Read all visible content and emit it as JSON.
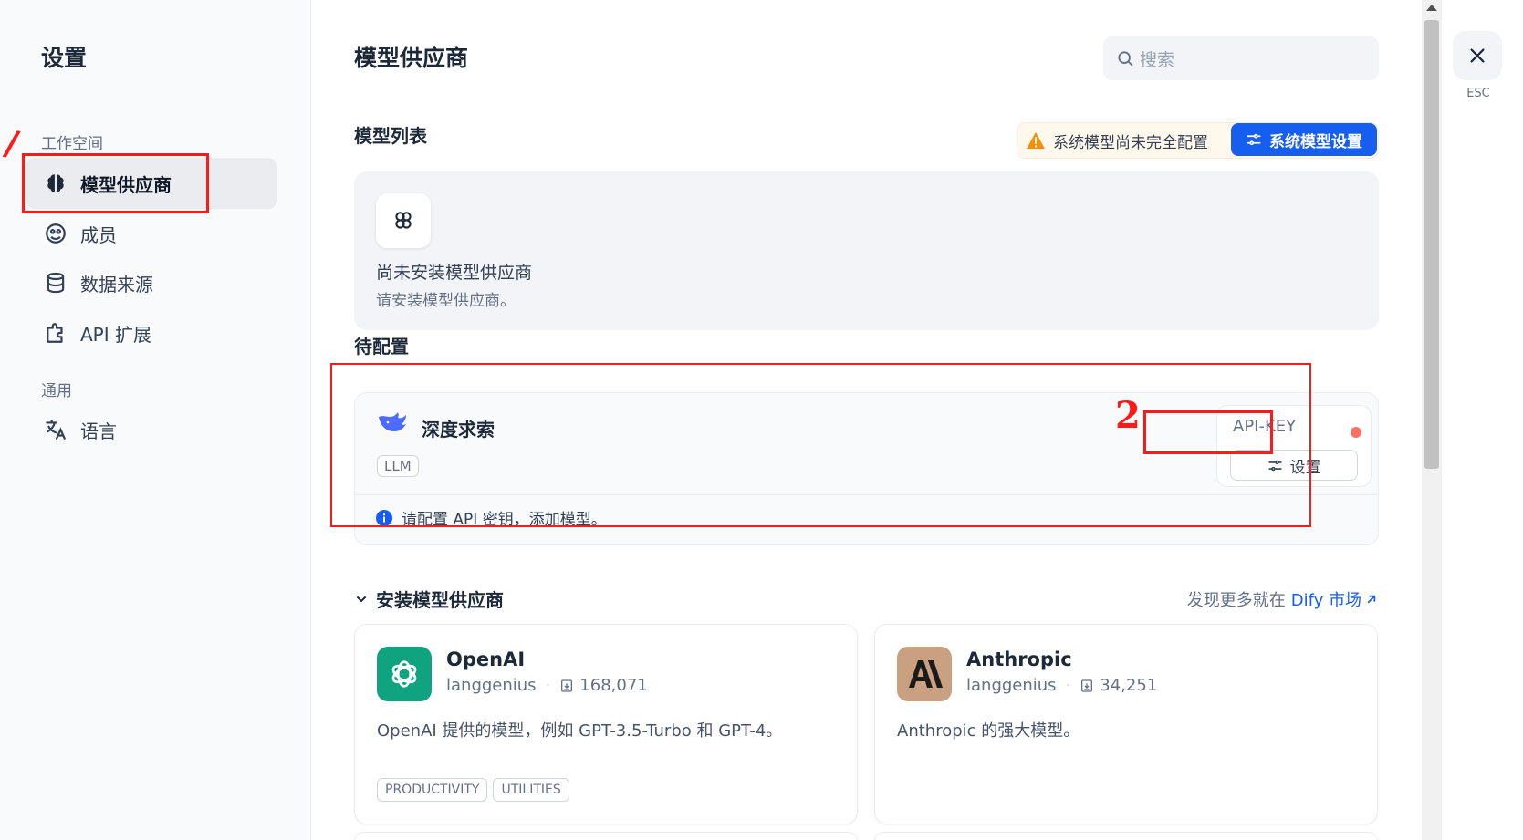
{
  "sidebar": {
    "title": "设置",
    "workspace_label": "工作空间",
    "general_label": "通用",
    "items": [
      {
        "label": "模型供应商",
        "icon": "brain-icon"
      },
      {
        "label": "成员",
        "icon": "members-icon"
      },
      {
        "label": "数据来源",
        "icon": "database-icon"
      },
      {
        "label": "API 扩展",
        "icon": "puzzle-icon"
      },
      {
        "label": "语言",
        "icon": "translate-icon"
      }
    ]
  },
  "main": {
    "title": "模型供应商",
    "search_placeholder": "搜索",
    "model_list_label": "模型列表",
    "warning_text": "系统模型尚未完全配置",
    "system_settings_button": "系统模型设置",
    "empty_title": "尚未安装模型供应商",
    "empty_desc": "请安装模型供应商。",
    "pending_label": "待配置",
    "pending_provider": {
      "name": "深度求索",
      "tag": "LLM",
      "apikey_label": "API-KEY",
      "setup_button": "设置",
      "info": "请配置 API 密钥，添加模型。"
    },
    "install_label": "安装模型供应商",
    "market_prefix": "发现更多就在",
    "market_link": "Dify 市场",
    "plugins": [
      {
        "name": "OpenAI",
        "author": "langgenius",
        "downloads": "168,071",
        "desc": "OpenAI 提供的模型，例如 GPT-3.5-Turbo 和 GPT-4。",
        "tags": [
          "PRODUCTIVITY",
          "UTILITIES"
        ],
        "color": "#10a37f"
      },
      {
        "name": "Anthropic",
        "author": "langgenius",
        "downloads": "34,251",
        "desc": "Anthropic 的强大模型。",
        "tags": [],
        "color": "#c9a080"
      }
    ]
  },
  "close": {
    "esc_label": "ESC"
  },
  "annotations": {
    "mark1": "/",
    "mark2": "2"
  },
  "colors": {
    "primary": "#155eef",
    "annotation": "#ff1a1a",
    "warning": "#f79009"
  }
}
